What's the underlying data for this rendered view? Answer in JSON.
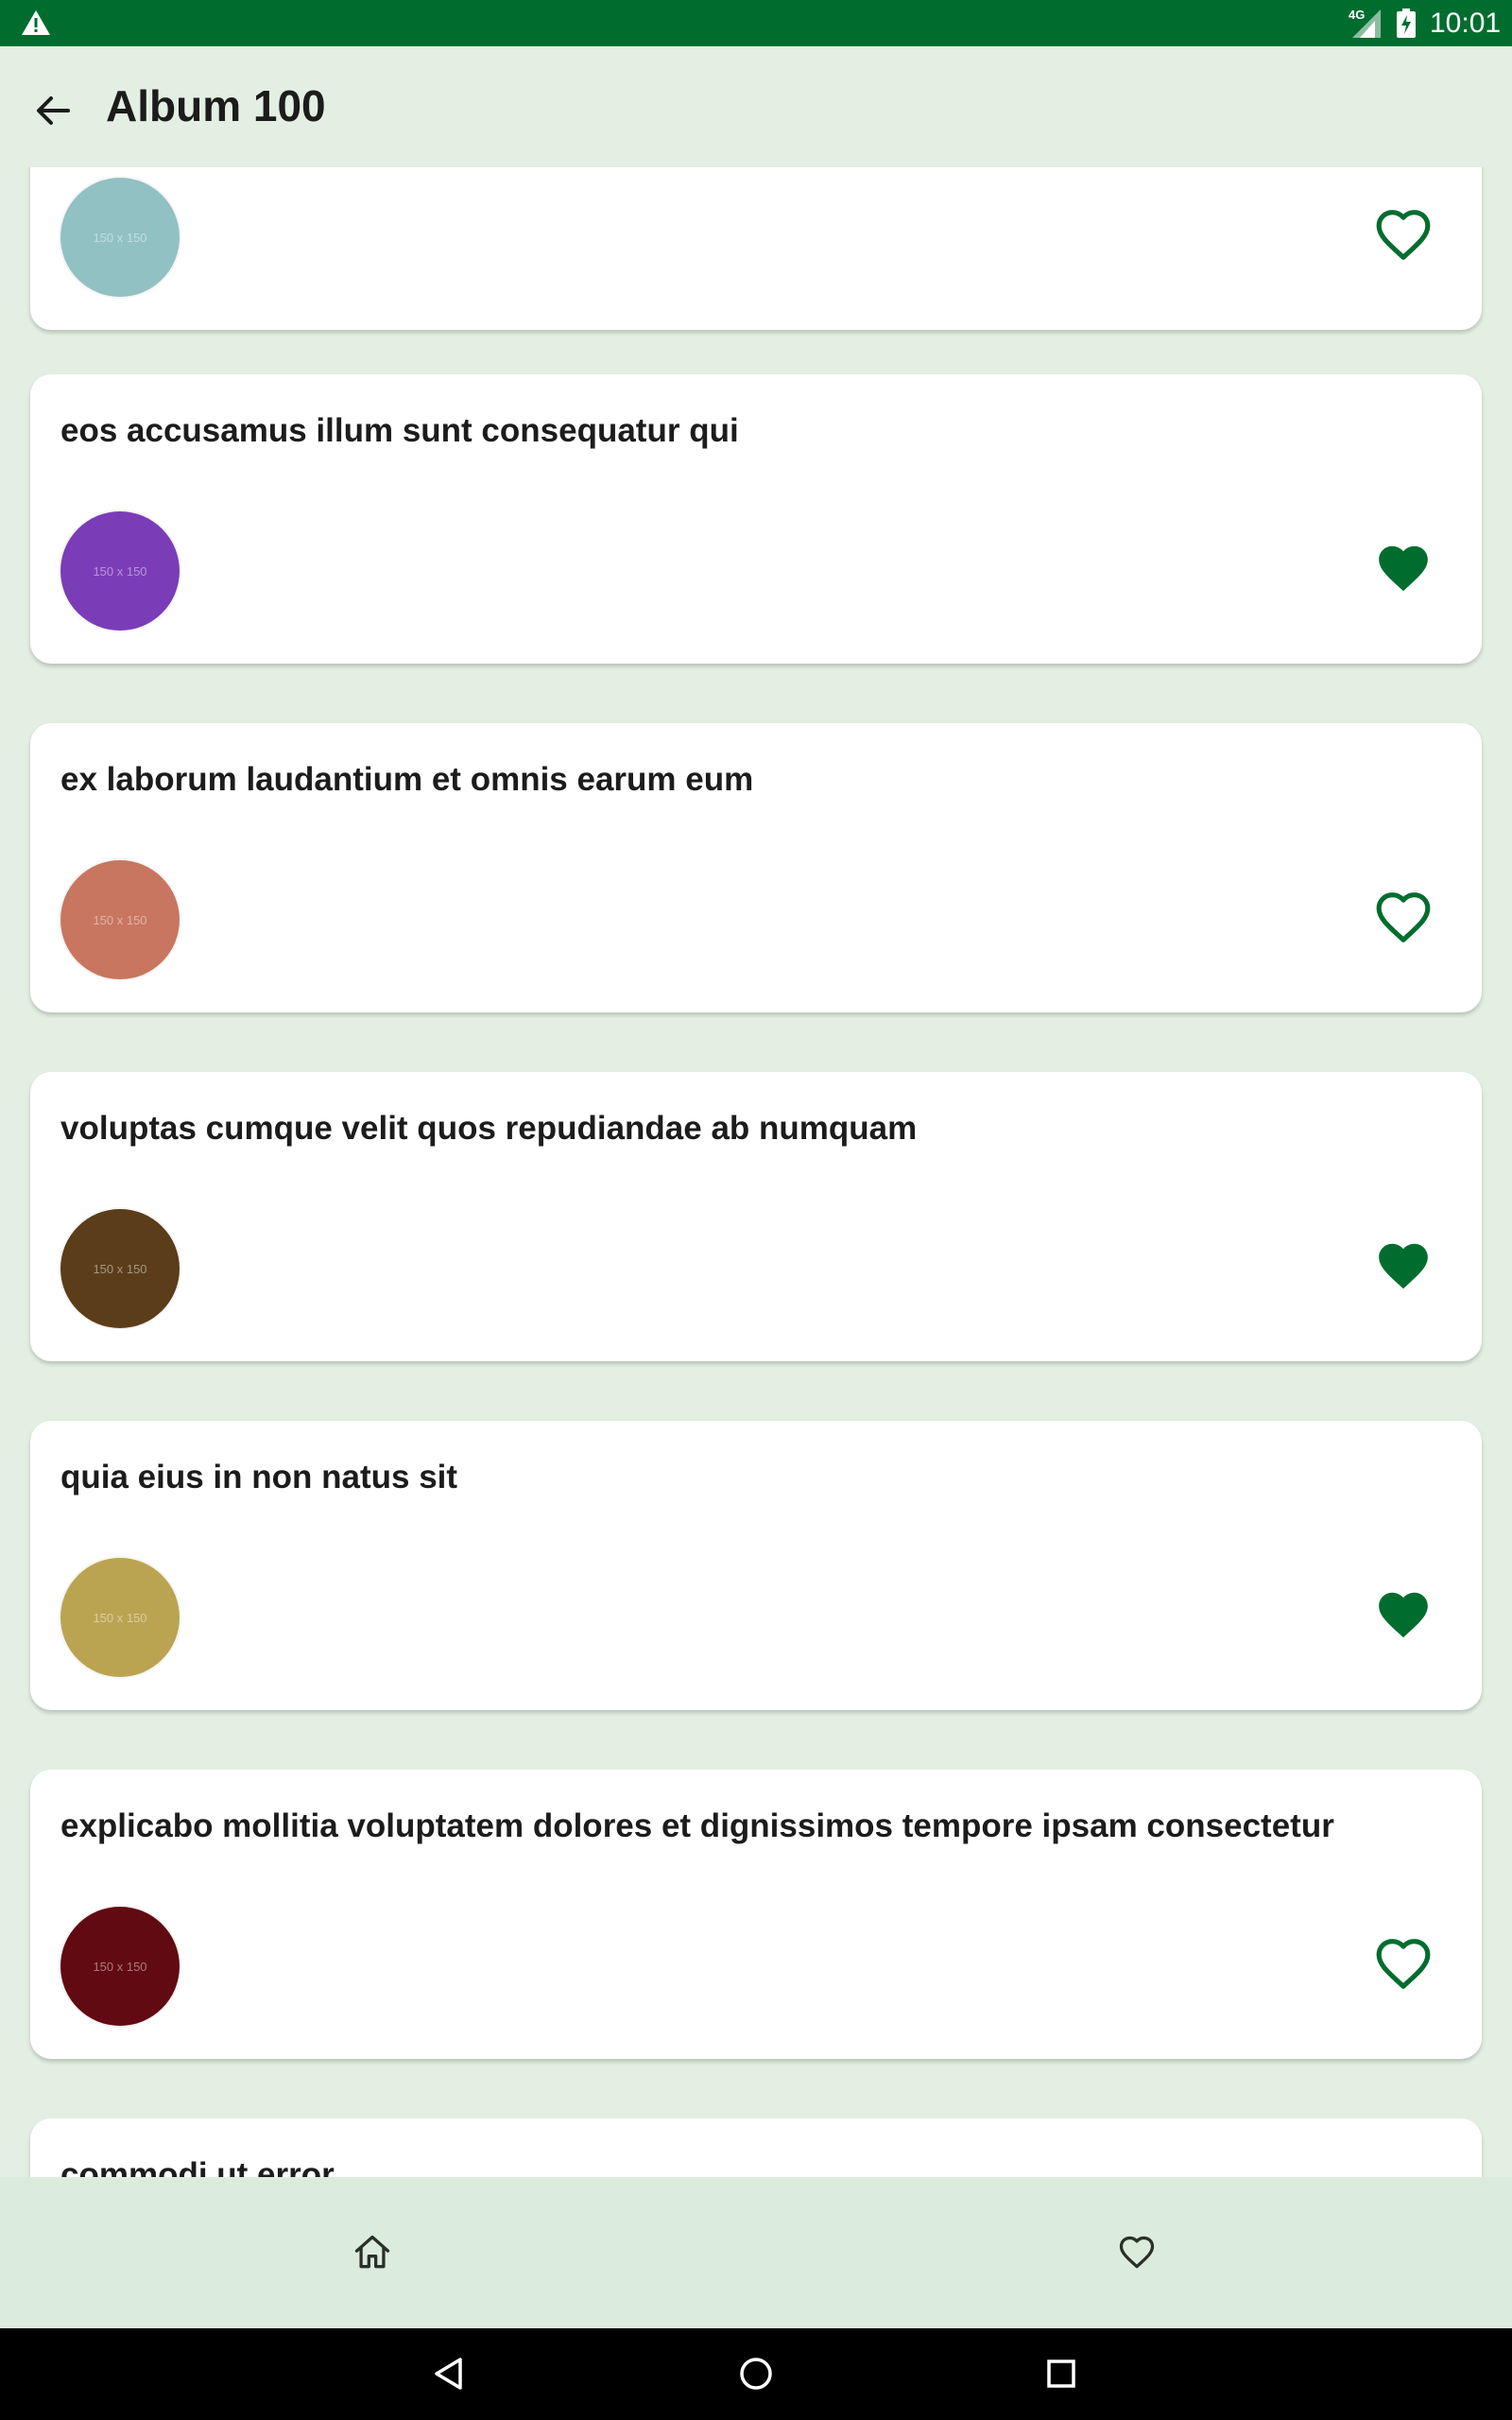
{
  "status_bar": {
    "time": "10:01",
    "network": "4G",
    "warning_icon": "warning-icon",
    "signal_icon": "signal-icon",
    "battery_icon": "battery-charging-icon"
  },
  "app_bar": {
    "title": "Album 100",
    "back_icon": "arrow-back-icon"
  },
  "colors": {
    "primary": "#006d2e",
    "background": "#e2efe2",
    "card": "#ffffff",
    "text": "#1b1c1b"
  },
  "photos": [
    {
      "title": "",
      "thumb_label": "150 x 150",
      "thumb_color": "#92c1c3",
      "favorite": false
    },
    {
      "title": "eos accusamus illum sunt consequatur qui",
      "thumb_label": "150 x 150",
      "thumb_color": "#7b3cb8",
      "favorite": true
    },
    {
      "title": "ex laborum laudantium et omnis earum eum",
      "thumb_label": "150 x 150",
      "thumb_color": "#c8765f",
      "favorite": false
    },
    {
      "title": "voluptas cumque velit quos repudiandae ab numquam",
      "thumb_label": "150 x 150",
      "thumb_color": "#5b3d1a",
      "favorite": true
    },
    {
      "title": "quia eius in non natus sit",
      "thumb_label": "150 x 150",
      "thumb_color": "#bba451",
      "favorite": true
    },
    {
      "title": "explicabo mollitia voluptatem dolores et dignissimos tempore ipsam consectetur",
      "thumb_label": "150 x 150",
      "thumb_color": "#620a11",
      "favorite": false
    },
    {
      "title": "commodi ut error",
      "thumb_label": "",
      "thumb_color": "#ffffff",
      "favorite": false
    }
  ],
  "bottom_nav": {
    "items": [
      {
        "icon": "home-icon"
      },
      {
        "icon": "heart-outline-icon"
      }
    ]
  },
  "system_nav": {
    "items": [
      {
        "icon": "back-triangle-icon"
      },
      {
        "icon": "home-circle-icon"
      },
      {
        "icon": "recents-square-icon"
      }
    ]
  }
}
